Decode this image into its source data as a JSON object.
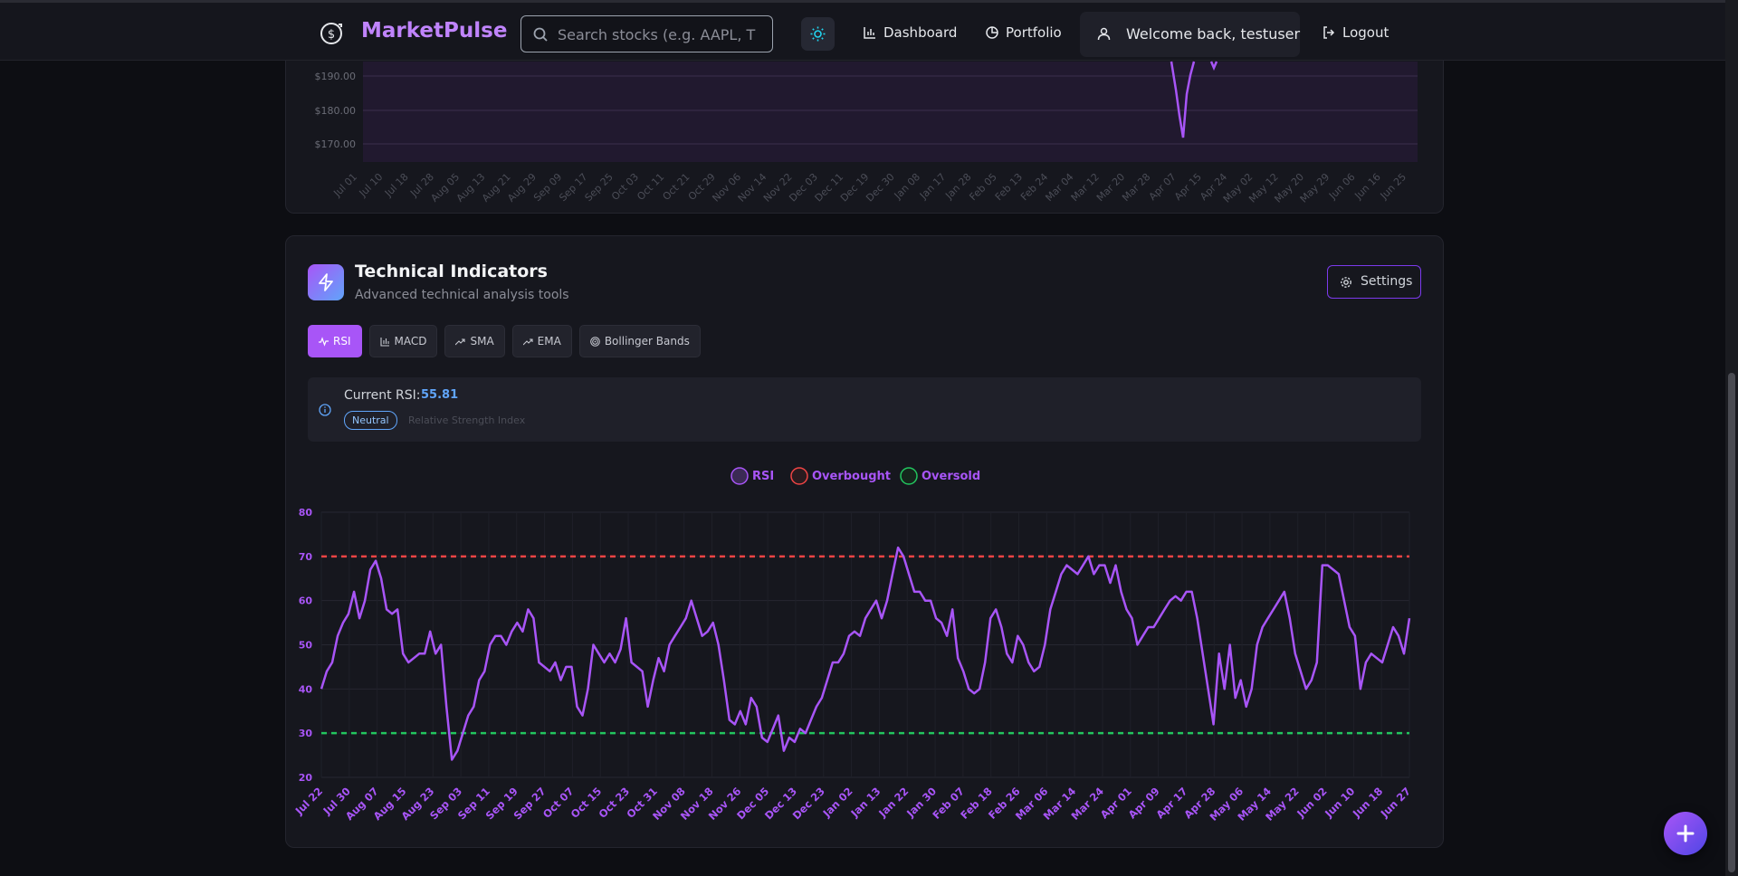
{
  "navbar": {
    "brand": "MarketPulse",
    "search_placeholder": "Search stocks (e.g. AAPL, T",
    "dashboard_label": "Dashboard",
    "portfolio_label": "Portfolio",
    "welcome_text": "Welcome back, testuser",
    "logout_label": "Logout"
  },
  "price_chart": {
    "y_ticks": [
      "$190.00",
      "$180.00",
      "$170.00"
    ],
    "x_ticks": [
      "Jul 01",
      "Jul 10",
      "Jul 18",
      "Jul 28",
      "Aug 05",
      "Aug 13",
      "Aug 21",
      "Aug 29",
      "Sep 09",
      "Sep 17",
      "Sep 25",
      "Oct 03",
      "Oct 11",
      "Oct 21",
      "Oct 29",
      "Nov 06",
      "Nov 14",
      "Nov 22",
      "Dec 03",
      "Dec 11",
      "Dec 19",
      "Dec 30",
      "Jan 08",
      "Jan 17",
      "Jan 28",
      "Feb 05",
      "Feb 13",
      "Feb 24",
      "Mar 04",
      "Mar 12",
      "Mar 20",
      "Mar 28",
      "Apr 07",
      "Apr 15",
      "Apr 24",
      "May 02",
      "May 12",
      "May 20",
      "May 29",
      "Jun 06",
      "Jun 16",
      "Jun 25"
    ],
    "accent_color": "#a855f7"
  },
  "technical_indicators": {
    "title": "Technical Indicators",
    "subtitle": "Advanced technical analysis tools",
    "settings_label": "Settings",
    "tabs": [
      {
        "label": "RSI",
        "icon": "activity-icon",
        "active": true
      },
      {
        "label": "MACD",
        "icon": "bar-chart-icon",
        "active": false
      },
      {
        "label": "SMA",
        "icon": "trending-up-icon",
        "active": false
      },
      {
        "label": "EMA",
        "icon": "trending-up-icon",
        "active": false
      },
      {
        "label": "Bollinger Bands",
        "icon": "target-icon",
        "active": false
      }
    ],
    "current_rsi_label": "Current RSI:",
    "current_rsi_value": "55.81",
    "status_badge": "Neutral",
    "indicator_description": "Relative Strength Index"
  },
  "chart_data": {
    "type": "line",
    "legend": [
      "RSI",
      "Overbought",
      "Oversold"
    ],
    "legend_colors": {
      "RSI": "#a855f7",
      "Overbought": "#ef4444",
      "Oversold": "#22c55e"
    },
    "legend_placement": "top-center",
    "ylim": [
      20,
      80
    ],
    "y_ticks": [
      "80",
      "70",
      "60",
      "50",
      "40",
      "30",
      "20"
    ],
    "x_ticks": [
      "Jul 22",
      "Jul 30",
      "Aug 07",
      "Aug 15",
      "Aug 23",
      "Sep 03",
      "Sep 11",
      "Sep 19",
      "Sep 27",
      "Oct 07",
      "Oct 15",
      "Oct 23",
      "Oct 31",
      "Nov 08",
      "Nov 18",
      "Nov 26",
      "Dec 05",
      "Dec 13",
      "Dec 23",
      "Jan 02",
      "Jan 13",
      "Jan 22",
      "Jan 30",
      "Feb 07",
      "Feb 18",
      "Feb 26",
      "Mar 06",
      "Mar 14",
      "Mar 24",
      "Apr 01",
      "Apr 09",
      "Apr 17",
      "Apr 28",
      "May 06",
      "May 14",
      "May 22",
      "Jun 02",
      "Jun 10",
      "Jun 18",
      "Jun 27"
    ],
    "grid": true,
    "overbought": 70,
    "oversold": 30,
    "series": [
      {
        "name": "RSI",
        "values": [
          40,
          44,
          46,
          52,
          55,
          57,
          62,
          56,
          60,
          67,
          69,
          65,
          58,
          57,
          58,
          48,
          46,
          47,
          48,
          48,
          53,
          48,
          50,
          36,
          24,
          26,
          30,
          34,
          36,
          42,
          44,
          50,
          52,
          52,
          50,
          53,
          55,
          53,
          58,
          56,
          46,
          45,
          44,
          46,
          42,
          45,
          45,
          36,
          34,
          40,
          50,
          48,
          46,
          48,
          46,
          49,
          56,
          46,
          45,
          44,
          36,
          42,
          47,
          44,
          50,
          52,
          54,
          56,
          60,
          56,
          52,
          53,
          55,
          50,
          42,
          33,
          32,
          35,
          32,
          38,
          36,
          29,
          28,
          31,
          34,
          26,
          29,
          28,
          31,
          30,
          33,
          36,
          38,
          42,
          46,
          46,
          48,
          52,
          53,
          52,
          56,
          58,
          60,
          56,
          60,
          66,
          72,
          70,
          66,
          62,
          62,
          60,
          60,
          56,
          55,
          52,
          58,
          47,
          44,
          40,
          39,
          40,
          46,
          56,
          58,
          54,
          48,
          46,
          52,
          50,
          46,
          44,
          45,
          50,
          58,
          62,
          66,
          68,
          67,
          66,
          68,
          70,
          66,
          68,
          68,
          64,
          68,
          62,
          58,
          56,
          50,
          52,
          54,
          54,
          56,
          58,
          60,
          61,
          60,
          62,
          62,
          56,
          48,
          40,
          32,
          48,
          40,
          50,
          38,
          42,
          36,
          40,
          50,
          54,
          56,
          58,
          60,
          62,
          56,
          48,
          44,
          40,
          42,
          46,
          68,
          68,
          67,
          66,
          60,
          54,
          52,
          40,
          46,
          48,
          47,
          46,
          50,
          54,
          52,
          48,
          56
        ]
      }
    ]
  }
}
